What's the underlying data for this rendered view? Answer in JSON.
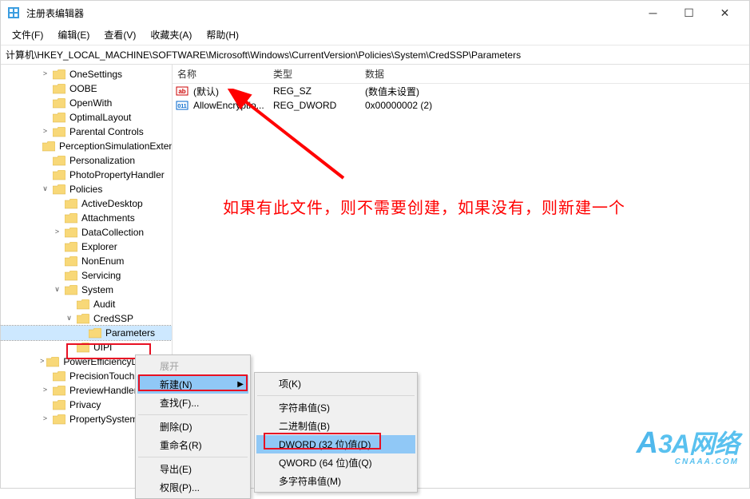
{
  "title": "注册表编辑器",
  "menu": {
    "file": "文件(F)",
    "edit": "编辑(E)",
    "view": "查看(V)",
    "fav": "收藏夹(A)",
    "help": "帮助(H)"
  },
  "address": "计算机\\HKEY_LOCAL_MACHINE\\SOFTWARE\\Microsoft\\Windows\\CurrentVersion\\Policies\\System\\CredSSP\\Parameters",
  "tree": [
    {
      "depth": 3,
      "exp": ">",
      "label": "OneSettings"
    },
    {
      "depth": 3,
      "exp": "",
      "label": "OOBE"
    },
    {
      "depth": 3,
      "exp": "",
      "label": "OpenWith"
    },
    {
      "depth": 3,
      "exp": "",
      "label": "OptimalLayout"
    },
    {
      "depth": 3,
      "exp": ">",
      "label": "Parental Controls"
    },
    {
      "depth": 3,
      "exp": "",
      "label": "PerceptionSimulationExtensions"
    },
    {
      "depth": 3,
      "exp": "",
      "label": "Personalization"
    },
    {
      "depth": 3,
      "exp": "",
      "label": "PhotoPropertyHandler"
    },
    {
      "depth": 3,
      "exp": "v",
      "label": "Policies"
    },
    {
      "depth": 4,
      "exp": "",
      "label": "ActiveDesktop"
    },
    {
      "depth": 4,
      "exp": "",
      "label": "Attachments"
    },
    {
      "depth": 4,
      "exp": ">",
      "label": "DataCollection"
    },
    {
      "depth": 4,
      "exp": "",
      "label": "Explorer"
    },
    {
      "depth": 4,
      "exp": "",
      "label": "NonEnum"
    },
    {
      "depth": 4,
      "exp": "",
      "label": "Servicing"
    },
    {
      "depth": 4,
      "exp": "v",
      "label": "System"
    },
    {
      "depth": 5,
      "exp": "",
      "label": "Audit"
    },
    {
      "depth": 5,
      "exp": "v",
      "label": "CredSSP"
    },
    {
      "depth": 6,
      "exp": "",
      "label": "Parameters",
      "sel": true
    },
    {
      "depth": 5,
      "exp": "",
      "label": "UIPI"
    },
    {
      "depth": 3,
      "exp": ">",
      "label": "PowerEfficiencyDiagnostics"
    },
    {
      "depth": 3,
      "exp": "",
      "label": "PrecisionTouchPad"
    },
    {
      "depth": 3,
      "exp": ">",
      "label": "PreviewHandlers"
    },
    {
      "depth": 3,
      "exp": "",
      "label": "Privacy"
    },
    {
      "depth": 3,
      "exp": ">",
      "label": "PropertySystem"
    }
  ],
  "listHdr": {
    "c1": "名称",
    "c2": "类型",
    "c3": "数据"
  },
  "listRows": [
    {
      "icon": "ab",
      "name": "(默认)",
      "type": "REG_SZ",
      "data": "(数值未设置)"
    },
    {
      "icon": "num",
      "name": "AllowEncryptio...",
      "type": "REG_DWORD",
      "data": "0x00000002 (2)"
    }
  ],
  "annotation": "如果有此文件，则不需要创建，如果没有，则新建一个",
  "ctx1": {
    "expand": "展开",
    "new": "新建(N)",
    "find": "查找(F)...",
    "delete": "删除(D)",
    "rename": "重命名(R)",
    "export": "导出(E)",
    "perm": "权限(P)..."
  },
  "ctx2": {
    "key": "项(K)",
    "string": "字符串值(S)",
    "binary": "二进制值(B)",
    "dword": "DWORD (32 位)值(D)",
    "qword": "QWORD (64 位)值(Q)",
    "multi": "多字符串值(M)"
  },
  "watermark": {
    "big": "3A网络",
    "small": "CNAAA.COM"
  }
}
